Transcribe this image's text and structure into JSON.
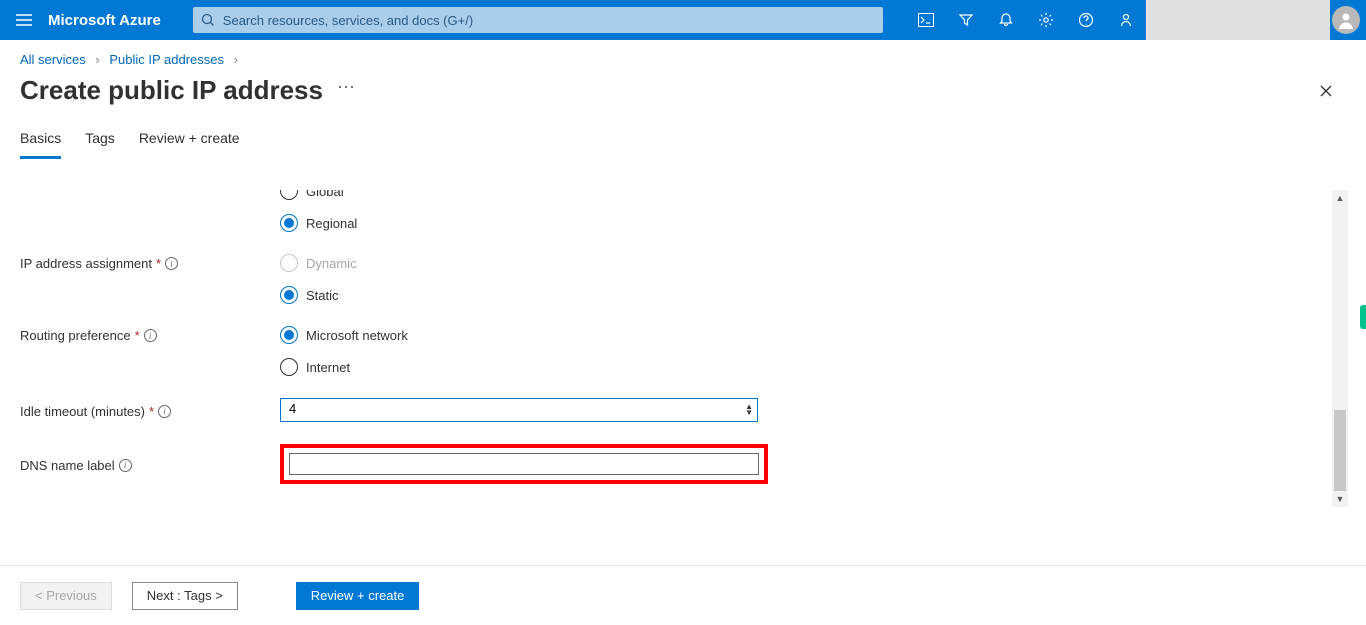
{
  "header": {
    "brand": "Microsoft Azure",
    "search_placeholder": "Search resources, services, and docs (G+/)"
  },
  "breadcrumbs": {
    "items": [
      "All services",
      "Public IP addresses"
    ],
    "title": "Create public IP address"
  },
  "tabs": {
    "items": [
      {
        "label": "Basics",
        "active": true
      },
      {
        "label": "Tags",
        "active": false
      },
      {
        "label": "Review + create",
        "active": false
      }
    ]
  },
  "form": {
    "tier": {
      "options": [
        {
          "label": "Global",
          "selected": false,
          "disabled": false
        },
        {
          "label": "Regional",
          "selected": true,
          "disabled": false
        }
      ]
    },
    "ip_assignment": {
      "label": "IP address assignment",
      "options": [
        {
          "label": "Dynamic",
          "selected": false,
          "disabled": true
        },
        {
          "label": "Static",
          "selected": true,
          "disabled": false
        }
      ]
    },
    "routing": {
      "label": "Routing preference",
      "options": [
        {
          "label": "Microsoft network",
          "selected": true,
          "disabled": false
        },
        {
          "label": "Internet",
          "selected": false,
          "disabled": false
        }
      ]
    },
    "idle_timeout": {
      "label": "Idle timeout (minutes)",
      "value": "4"
    },
    "dns": {
      "label": "DNS name label",
      "value": ""
    }
  },
  "footer": {
    "previous": "< Previous",
    "next": "Next : Tags >",
    "review": "Review + create"
  }
}
